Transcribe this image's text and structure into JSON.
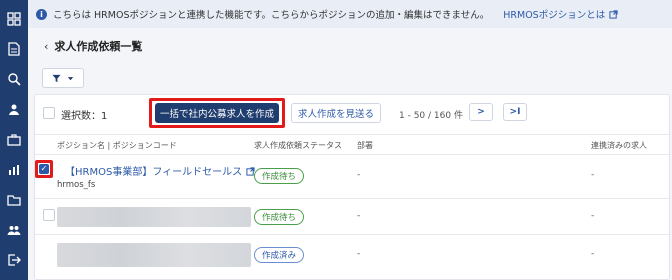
{
  "sidebar": {
    "icons": [
      "dashboard-icon",
      "document-icon",
      "search-icon",
      "recruiter-icon",
      "briefcase-icon",
      "chart-icon",
      "folder-icon",
      "people-icon",
      "logout-icon"
    ]
  },
  "info_bar": {
    "icon": "i",
    "text": "こちらは HRMOSポジションと連携した機能です。こちらからポジションの追加・編集はできません。",
    "link": "HRMOSポジションとは"
  },
  "header": {
    "back": "‹",
    "title": "求人作成依頼一覧"
  },
  "toolbar": {
    "selected_count": "選択数：1",
    "primary_button": "一括で社内公募求人を作成",
    "secondary_button": "求人作成を見送る",
    "pagination": "1 - 50 / 160 件",
    "next": ">",
    "last": ">I"
  },
  "table": {
    "headers": {
      "position": "ポジション名 | ポジションコード",
      "status": "求人作成依頼ステータス",
      "department": "部署",
      "linked": "連携済みの求人"
    },
    "rows": [
      {
        "name": "【HRMOS事業部】フィールドセールス",
        "code": "hrmos_fs",
        "status": "作成待ち",
        "department": "-",
        "linked": "-"
      },
      {
        "name": "",
        "code": "",
        "status": "作成待ち",
        "department": "-",
        "linked": "-"
      },
      {
        "name": "",
        "code": "",
        "status": "作成済み",
        "department": "-",
        "linked": "-"
      }
    ]
  },
  "colors": {
    "sidebar": "#1f3d6e",
    "accent": "#2d5aa8",
    "highlight": "#e21a1a",
    "status_wait": "#3c8c3c",
    "status_done": "#2d5aa8"
  }
}
